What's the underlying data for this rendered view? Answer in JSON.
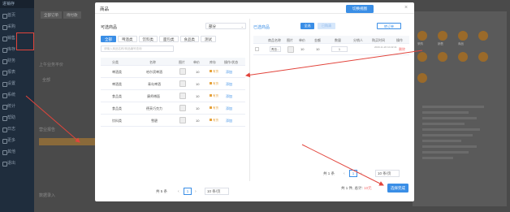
{
  "background": {
    "logo": "进销存",
    "menu": [
      "首页",
      "采购",
      "销售",
      "库存",
      "财务",
      "报表",
      "设置",
      "系统",
      "统计",
      "帮助",
      "日志",
      "更多",
      "其他",
      "退出"
    ],
    "tabs": [
      "全部订单",
      "待付款"
    ],
    "left_texts": [
      "上午业务平价",
      "全部",
      "营业报告",
      "助手",
      "商品信息",
      "帮助",
      "操作",
      "数据录入"
    ],
    "right_icons": [
      "采购",
      "销售",
      "商品",
      "",
      "库存",
      "出库",
      "入库",
      "",
      "退款",
      "设置",
      "统计",
      "",
      "查询"
    ]
  },
  "modal": {
    "title": "商品",
    "switch_button": "切换视图",
    "close": "×",
    "left": {
      "title": "可选商品",
      "select_value": "部分",
      "tabs": [
        "全部",
        "啤酒类",
        "饮料类",
        "面包类",
        "食品类",
        "测试"
      ],
      "search_placeholder": "请输入商品名称/商品编号查询",
      "headers": [
        "分类",
        "名称",
        "图片",
        "单价",
        "库存",
        "操作/状态"
      ],
      "rows": [
        {
          "category": "啤酒类",
          "name": "哈尔滨啤酒",
          "price": "10",
          "stock": "有货",
          "action": "添加"
        },
        {
          "category": "啤酒类",
          "name": "青岛啤酒",
          "price": "10",
          "stock": "有货",
          "action": "添加"
        },
        {
          "category": "食品类",
          "name": "康师傅面",
          "price": "10",
          "stock": "有货",
          "action": "添加"
        },
        {
          "category": "食品类",
          "name": "德芙巧克力",
          "price": "10",
          "stock": "有货",
          "action": "添加"
        },
        {
          "category": "饮料类",
          "name": "雪碧",
          "price": "10",
          "stock": "有货",
          "action": "添加"
        }
      ],
      "pagination": {
        "total": "共 5 条",
        "prev": "‹",
        "page": "1",
        "next": "›",
        "size": "10 条/页"
      }
    },
    "right": {
      "title": "已选商品",
      "all_button": "全选",
      "clear_button": "已购清",
      "order_button": "转订单",
      "headers": [
        "商品名称",
        "图片",
        "单价",
        "金额",
        "数量",
        "分销人",
        "购买时间",
        "操作"
      ],
      "rows": [
        {
          "name": "青岛...",
          "price": "10",
          "amount": "10",
          "qty": "1",
          "date": "2020-11-20 10:22:41",
          "action": "删除"
        }
      ],
      "pagination": {
        "total": "共 1 条",
        "prev": "‹",
        "page": "1",
        "next": "›",
        "size": "10 条/页"
      },
      "summary": {
        "count": "共 1 件,",
        "total_label": "总计:",
        "total_value": "10元"
      },
      "done_button": "选择完成"
    }
  },
  "colors": {
    "accent": "#3a8ee6",
    "annotation": "#e2443b"
  }
}
